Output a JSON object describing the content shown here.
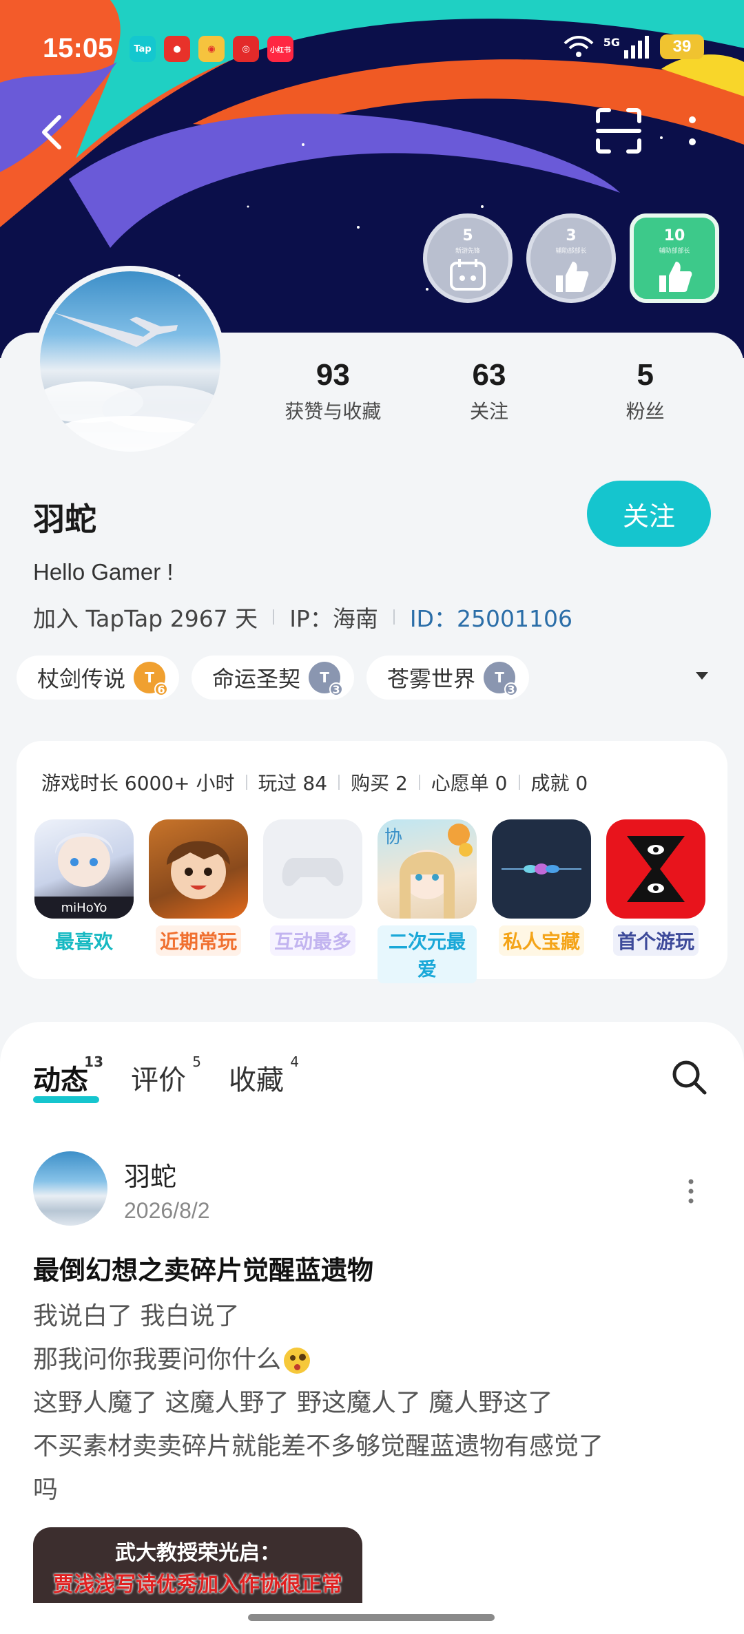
{
  "status_bar": {
    "time": "15:05",
    "network": "5G",
    "battery": "39",
    "apps": [
      {
        "name": "taptap-icon",
        "label": "Tap",
        "color": "#14c7cf"
      },
      {
        "name": "tieba-icon",
        "label": "",
        "color": "#e8322a"
      },
      {
        "name": "weibo-icon",
        "label": "",
        "color": "#f6c33e"
      },
      {
        "name": "netease-music-icon",
        "label": "",
        "color": "#e32a2a"
      },
      {
        "name": "xiaohongshu-icon",
        "label": "小红书",
        "color": "#ff2742"
      }
    ]
  },
  "badges": [
    {
      "num": "5",
      "label": "新游先锋"
    },
    {
      "num": "3",
      "label": "辅助部部长"
    },
    {
      "num": "10",
      "label": "辅助部部长"
    }
  ],
  "profile": {
    "stats": [
      {
        "value": "93",
        "label": "获赞与收藏"
      },
      {
        "value": "63",
        "label": "关注"
      },
      {
        "value": "5",
        "label": "粉丝"
      }
    ],
    "username": "羽蛇",
    "follow_label": "关注",
    "bio": "Hello Gamer !",
    "joined": "加入 TapTap 2967 天",
    "ip": "IP：海南",
    "id": "ID：25001106"
  },
  "tags": [
    {
      "label": "杖剑传说",
      "level": "6",
      "color": "#f0a030"
    },
    {
      "label": "命运圣契",
      "level": "3",
      "color": "#8a96b0"
    },
    {
      "label": "苍雾世界",
      "level": "3",
      "color": "#8a96b0"
    }
  ],
  "game_stats": {
    "items": [
      "游戏时长 6000+ 小时",
      "玩过 84",
      "购买 2",
      "心愿单 0",
      "成就 0"
    ],
    "games": [
      {
        "tag": "最喜欢",
        "tag_color": "#17b9c2",
        "tag_bg": "#ffffff"
      },
      {
        "tag": "近期常玩",
        "tag_color": "#f07030",
        "tag_bg": "#fff1e8"
      },
      {
        "tag": "互动最多",
        "tag_color": "#c2b4f0",
        "tag_bg": "#f6f3ff"
      },
      {
        "tag": "二次元最爱",
        "tag_color": "#1aa8d8",
        "tag_bg": "#e7f7fd"
      },
      {
        "tag": "私人宝藏",
        "tag_color": "#f4a418",
        "tag_bg": "#fff7e4"
      },
      {
        "tag": "首个游玩",
        "tag_color": "#3d4a9a",
        "tag_bg": "#eef0fa"
      }
    ]
  },
  "feed": {
    "tabs": [
      {
        "label": "动态",
        "count": "13"
      },
      {
        "label": "评价",
        "count": "5"
      },
      {
        "label": "收藏",
        "count": "4"
      }
    ],
    "post": {
      "user": "羽蛇",
      "date": "2026/8/2",
      "title": "最倒幻想之卖碎片觉醒蓝遗物",
      "lines": [
        "我说白了 我白说了",
        "那我问你我要问你什么",
        "这野人魔了 这魔人野了 野这魔人了 魔人野这了",
        "不买素材卖卖碎片就能差不多够觉醒蓝遗物有感觉了",
        "吗"
      ],
      "image_line1": "武大教授荣光启：",
      "image_line2": "贾浅浅写诗优秀加入作协很正常"
    }
  }
}
